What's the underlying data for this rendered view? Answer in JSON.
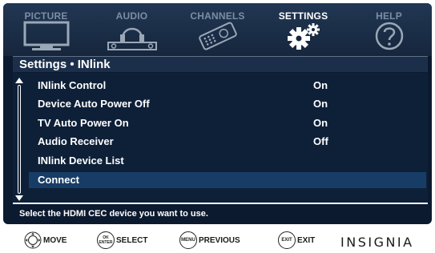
{
  "topmenu": {
    "tabs": [
      {
        "label": "PICTURE",
        "icon": "tv-icon"
      },
      {
        "label": "AUDIO",
        "icon": "speaker-icon"
      },
      {
        "label": "CHANNELS",
        "icon": "remote-icon"
      },
      {
        "label": "SETTINGS",
        "icon": "gears-icon"
      },
      {
        "label": "HELP",
        "icon": "question-icon"
      }
    ],
    "active_tab": "SETTINGS"
  },
  "breadcrumb": "Settings • INlink",
  "menu": {
    "items": [
      {
        "label": "INlink Control",
        "value": "On"
      },
      {
        "label": "Device Auto Power Off",
        "value": "On"
      },
      {
        "label": "TV Auto Power On",
        "value": "On"
      },
      {
        "label": "Audio Receiver",
        "value": "Off"
      },
      {
        "label": "INlink Device List",
        "value": ""
      },
      {
        "label": "Connect",
        "value": ""
      }
    ],
    "selected": "Connect"
  },
  "help_text": "Select the HDMI CEC device you want to use.",
  "legend": {
    "move": {
      "label": "MOVE",
      "icon": "dpad-icon"
    },
    "select": {
      "label": "SELECT",
      "button": "OK ENTER"
    },
    "previous": {
      "label": "PREVIOUS",
      "button": "MENU"
    },
    "exit": {
      "label": "EXIT",
      "button": "EXIT"
    }
  },
  "brand": "INSIGNIA",
  "colors": {
    "background": "#0c1a30",
    "selected_row": "#173d67",
    "header": "#1c2f4a"
  }
}
